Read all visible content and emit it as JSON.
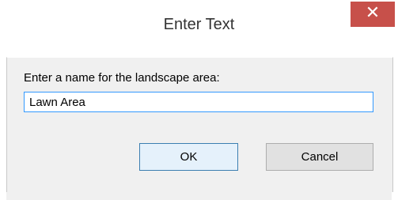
{
  "dialog": {
    "title": "Enter Text",
    "close_symbol": "✕",
    "prompt": "Enter a name for the landscape area:",
    "input_value": "Lawn Area",
    "ok_label": "OK",
    "cancel_label": "Cancel"
  },
  "colors": {
    "close_button": "#c7504a",
    "focus_border": "#3399ff",
    "dialog_background": "#f0f0f0"
  }
}
